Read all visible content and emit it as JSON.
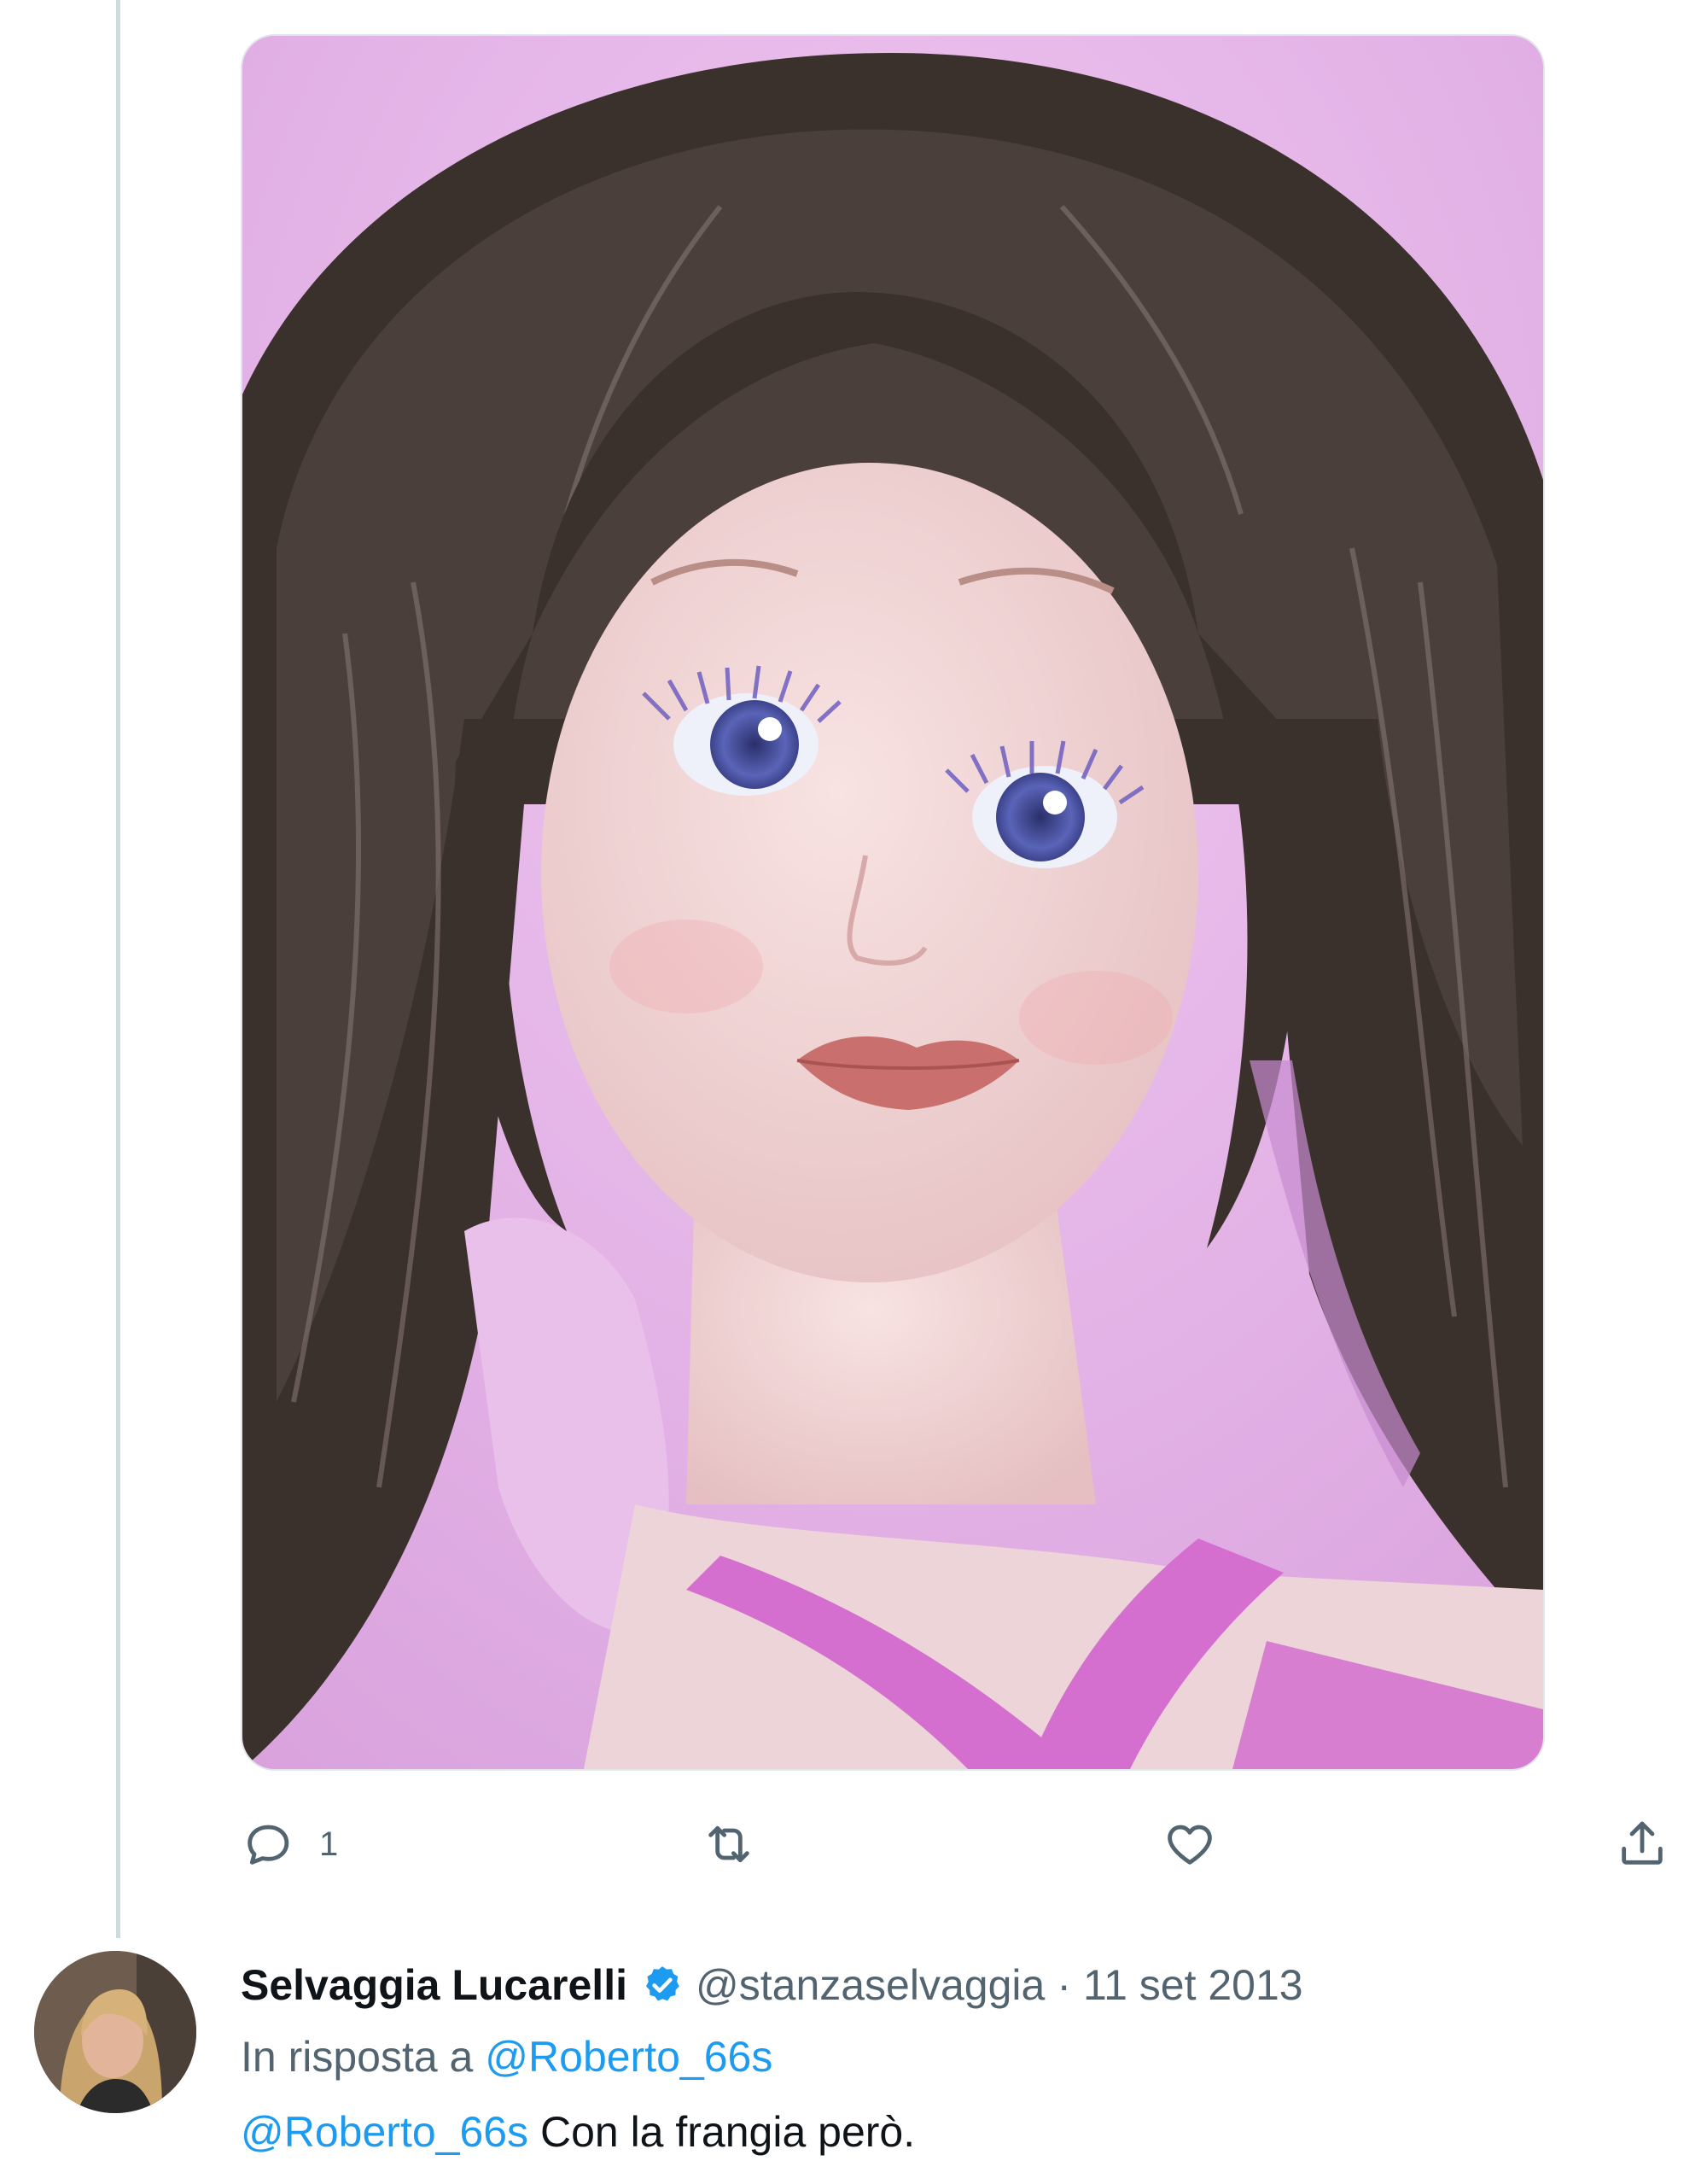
{
  "thread": {
    "media_alt": "",
    "actions": {
      "reply_count": "1",
      "retweet_count": "",
      "like_count": ""
    }
  },
  "reply": {
    "display_name": "Selvaggia Lucarelli",
    "handle": "@stanzaselvaggia",
    "separator": "·",
    "date": "11 set 2013",
    "reply_context_prefix": "In risposta a",
    "reply_context_handle": "@Roberto_66s",
    "text_mention": "@Roberto_66s",
    "text": " Con la frangia però."
  },
  "colors": {
    "accent": "#1d9bf0",
    "secondary_text": "#536471",
    "primary_text": "#0f1419",
    "thread_line": "#cfd9de"
  },
  "icons": {
    "reply": "reply-icon",
    "retweet": "retweet-icon",
    "like": "heart-icon",
    "share": "share-icon",
    "verified": "verified-badge-icon"
  }
}
